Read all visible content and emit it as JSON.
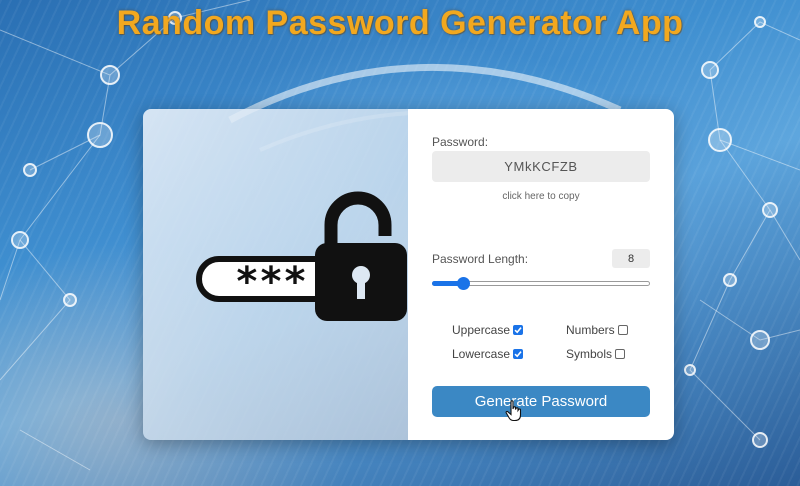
{
  "app_title": "Random Password Generator App",
  "password": {
    "label": "Password:",
    "value": "YMkKCFZB",
    "copy_hint": "click here to copy"
  },
  "length": {
    "label": "Password Length:",
    "value": "8",
    "min": 4,
    "max": 32,
    "current": 8
  },
  "options": {
    "uppercase": {
      "label": "Uppercase",
      "checked": true
    },
    "lowercase": {
      "label": "Lowercase",
      "checked": true
    },
    "numbers": {
      "label": "Numbers",
      "checked": false
    },
    "symbols": {
      "label": "Symbols",
      "checked": false
    }
  },
  "generate_label": "Generate Password",
  "illustration": {
    "masked_text": "***"
  },
  "colors": {
    "title": "#f2a81f",
    "accent": "#1a73e8",
    "button": "#3b88c4"
  },
  "icons": {
    "padlock": "open-padlock-icon",
    "cursor": "hand-pointer-icon",
    "check": "checkmark-icon"
  }
}
